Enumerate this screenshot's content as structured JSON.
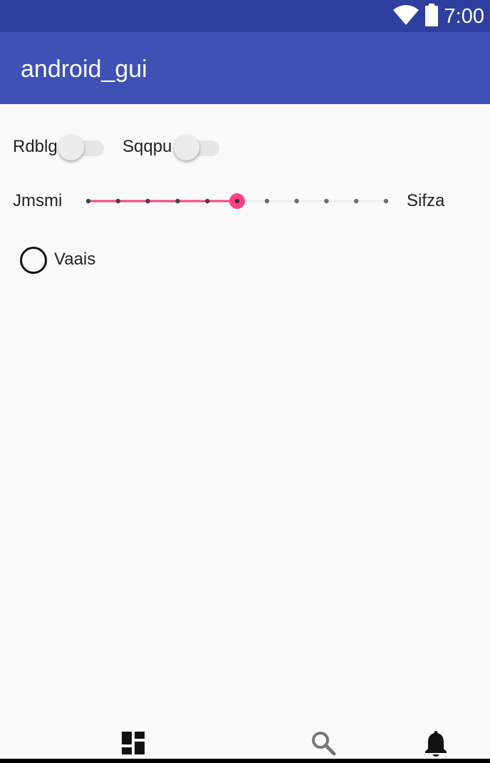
{
  "status_bar": {
    "time": "7:00",
    "icons": [
      "wifi-icon",
      "battery-icon"
    ],
    "color": "#2f3f9f"
  },
  "app_bar": {
    "title": "android_gui",
    "color": "#3f51b5"
  },
  "toggles": [
    {
      "label": "Rdblg",
      "checked": false
    },
    {
      "label": "Sqqpu",
      "checked": false
    }
  ],
  "slider": {
    "label_left": "Jmsmi",
    "label_right": "Sifza",
    "min": 0,
    "max": 10,
    "value": 5,
    "accent": "#ff4081"
  },
  "radio": {
    "label": "Vaais",
    "checked": false
  },
  "bottom_nav": {
    "items": [
      "dashboard-icon",
      "search-icon",
      "notifications-icon"
    ]
  }
}
